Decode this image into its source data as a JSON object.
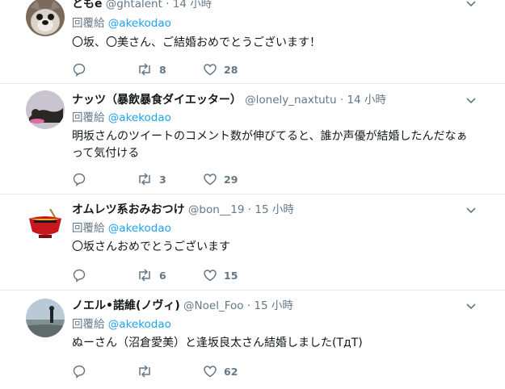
{
  "tweets": [
    {
      "name": "ともe",
      "handle": "@ghtalent",
      "time": "14 小時",
      "reply_prefix": "回覆給",
      "reply_to": "@akekodao",
      "text": "〇坂、〇美さん、ご結婚おめでとうございます！",
      "retweets": "8",
      "likes": "28",
      "replies": ""
    },
    {
      "name": "ナッツ（暴飲暴食ダイエッター）",
      "handle": "@lonely_naxtutu",
      "time": "14 小時",
      "reply_prefix": "回覆給",
      "reply_to": "@akekodao",
      "text": "明坂さんのツイートのコメント数が伸びてると、誰か声優が結婚したんだなぁって気付ける",
      "retweets": "3",
      "likes": "29",
      "replies": ""
    },
    {
      "name": "オムレツ系おみおつけ",
      "handle": "@bon__19",
      "time": "15 小時",
      "reply_prefix": "回覆給",
      "reply_to": "@akekodao",
      "text": "〇坂さんおめでとうございます",
      "retweets": "6",
      "likes": "15",
      "replies": ""
    },
    {
      "name": "ノエル•諾維(ノヴィ)",
      "handle": "@Noel_Foo",
      "time": "15 小時",
      "reply_prefix": "回覆給",
      "reply_to": "@akekodao",
      "text": "ぬーさん（沼倉愛美）と逢坂良太さん結婚しました(TдT)",
      "retweets": "",
      "likes": "62",
      "replies": ""
    }
  ],
  "colors": {
    "link": "#1da1f2",
    "muted": "#657786",
    "text": "#14171a",
    "divider": "#e6ecf0"
  },
  "icons": [
    "reply-icon",
    "retweet-icon",
    "like-icon",
    "caret-down-icon"
  ]
}
